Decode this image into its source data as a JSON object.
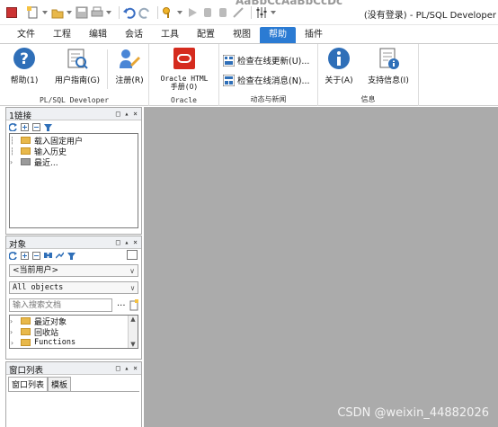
{
  "window": {
    "title": "(没有登录) - PL/SQL Developer",
    "cut_title": "AaBbCcAaBbCcDc"
  },
  "ribbon": {
    "tabs": [
      "文件",
      "工程",
      "编辑",
      "会话",
      "工具",
      "配置",
      "视图",
      "帮助",
      "插件"
    ],
    "active_tab": "帮助",
    "groups": {
      "pl_sql_developer": {
        "label": "PL/SQL Developer",
        "help_label": "帮助(1)",
        "user_guide_label": "用户指南(G)",
        "register_label": "注册(R)"
      },
      "oracle": {
        "label": "Oracle",
        "html_manual_line1": "Oracle HTML",
        "html_manual_line2": "手册(O)"
      },
      "news": {
        "label": "动态与新闻",
        "check_updates_label": "检查在线更新(U)...",
        "check_news_label": "检查在线消息(N)..."
      },
      "info": {
        "label": "信息",
        "about_label": "关于(A)",
        "support_label": "支持信息(I)"
      }
    }
  },
  "connections_panel": {
    "title": "1链接",
    "controls": "□ ▴ ×",
    "items": [
      {
        "label": "载入固定用户",
        "expandable": false
      },
      {
        "label": "输入历史",
        "expandable": false
      },
      {
        "label": "最近...",
        "expandable": true
      }
    ]
  },
  "objects_panel": {
    "title": "对象",
    "controls": "□ ▴ ×",
    "user_select": "<当前用户>",
    "type_select": "All objects",
    "search_placeholder": "输入搜索文档",
    "search_more": "...",
    "items": [
      {
        "label": "最近对象"
      },
      {
        "label": "回收站"
      },
      {
        "label": "Functions"
      }
    ]
  },
  "window_list_panel": {
    "title": "窗口列表",
    "controls": "□ ▴ ×",
    "tabs": [
      "窗口列表",
      "模板"
    ],
    "active_tab": "窗口列表"
  },
  "watermark": "CSDN @weixin_44882026",
  "colors": {
    "accent": "#2b7bd3",
    "workspace": "#ababab"
  }
}
